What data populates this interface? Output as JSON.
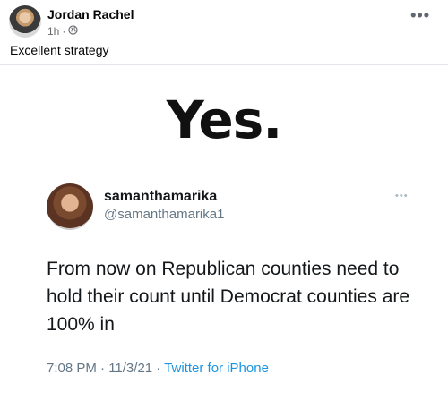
{
  "post": {
    "author": "Jordan Rachel",
    "time": "1h",
    "separator": "·",
    "caption": "Excellent strategy",
    "more_label": "•••"
  },
  "image": {
    "headline": "Yes.",
    "tweet": {
      "name": "samanthamarika",
      "handle": "@samanthamarika1",
      "more_label": "•••",
      "text": "From now on Republican counties need to hold their count until Democrat counties are 100% in",
      "time": "7:08 PM · 11/3/21 · ",
      "source": "Twitter for iPhone"
    }
  },
  "colors": {
    "secondary_text": "#65676b",
    "twitter_blue": "#1b95e0"
  }
}
